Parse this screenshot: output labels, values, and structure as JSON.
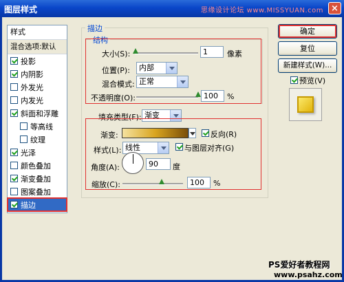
{
  "window": {
    "title": "图层样式",
    "watermark": "思缘设计论坛 www.MISSYUAN.com"
  },
  "sidebar": {
    "header": "样式",
    "blend_options": "混合选项:默认",
    "items": [
      {
        "label": "投影",
        "checked": true
      },
      {
        "label": "内阴影",
        "checked": true
      },
      {
        "label": "外发光",
        "checked": false
      },
      {
        "label": "内发光",
        "checked": false
      },
      {
        "label": "斜面和浮雕",
        "checked": true
      },
      {
        "label": "等高线",
        "checked": false
      },
      {
        "label": "纹理",
        "checked": false
      },
      {
        "label": "光泽",
        "checked": true
      },
      {
        "label": "颜色叠加",
        "checked": false
      },
      {
        "label": "渐变叠加",
        "checked": true
      },
      {
        "label": "图案叠加",
        "checked": false
      },
      {
        "label": "描边",
        "checked": true
      }
    ]
  },
  "stroke": {
    "section_title": "描边",
    "structure_title": "结构",
    "size_label": "大小(S):",
    "size_value": "1",
    "size_unit": "像素",
    "position_label": "位置(P):",
    "position_value": "内部",
    "blend_mode_label": "混合模式:",
    "blend_mode_value": "正常",
    "opacity_label": "不透明度(O):",
    "opacity_value": "100",
    "opacity_unit": "%",
    "fill_type_label": "填充类型(F):",
    "fill_type_value": "渐变",
    "gradient_label": "渐变:",
    "reverse_label": "反向(R)",
    "reverse_checked": true,
    "style_label": "样式(L):",
    "style_value": "线性",
    "align_label": "与图层对齐(G)",
    "align_checked": true,
    "angle_label": "角度(A):",
    "angle_value": "90",
    "angle_unit": "度",
    "scale_label": "缩放(C):",
    "scale_value": "100",
    "scale_unit": "%"
  },
  "buttons": {
    "ok": "确定",
    "reset": "复位",
    "new_style": "新建样式(W)...",
    "preview_label": "预览(V)",
    "preview_checked": true
  },
  "footer": {
    "line1": "PS爱好者教程网",
    "line2": "www.psahz.com"
  },
  "colors": {
    "accent": "#0046d5",
    "highlight": "#e03030",
    "selection": "#316ac5"
  }
}
